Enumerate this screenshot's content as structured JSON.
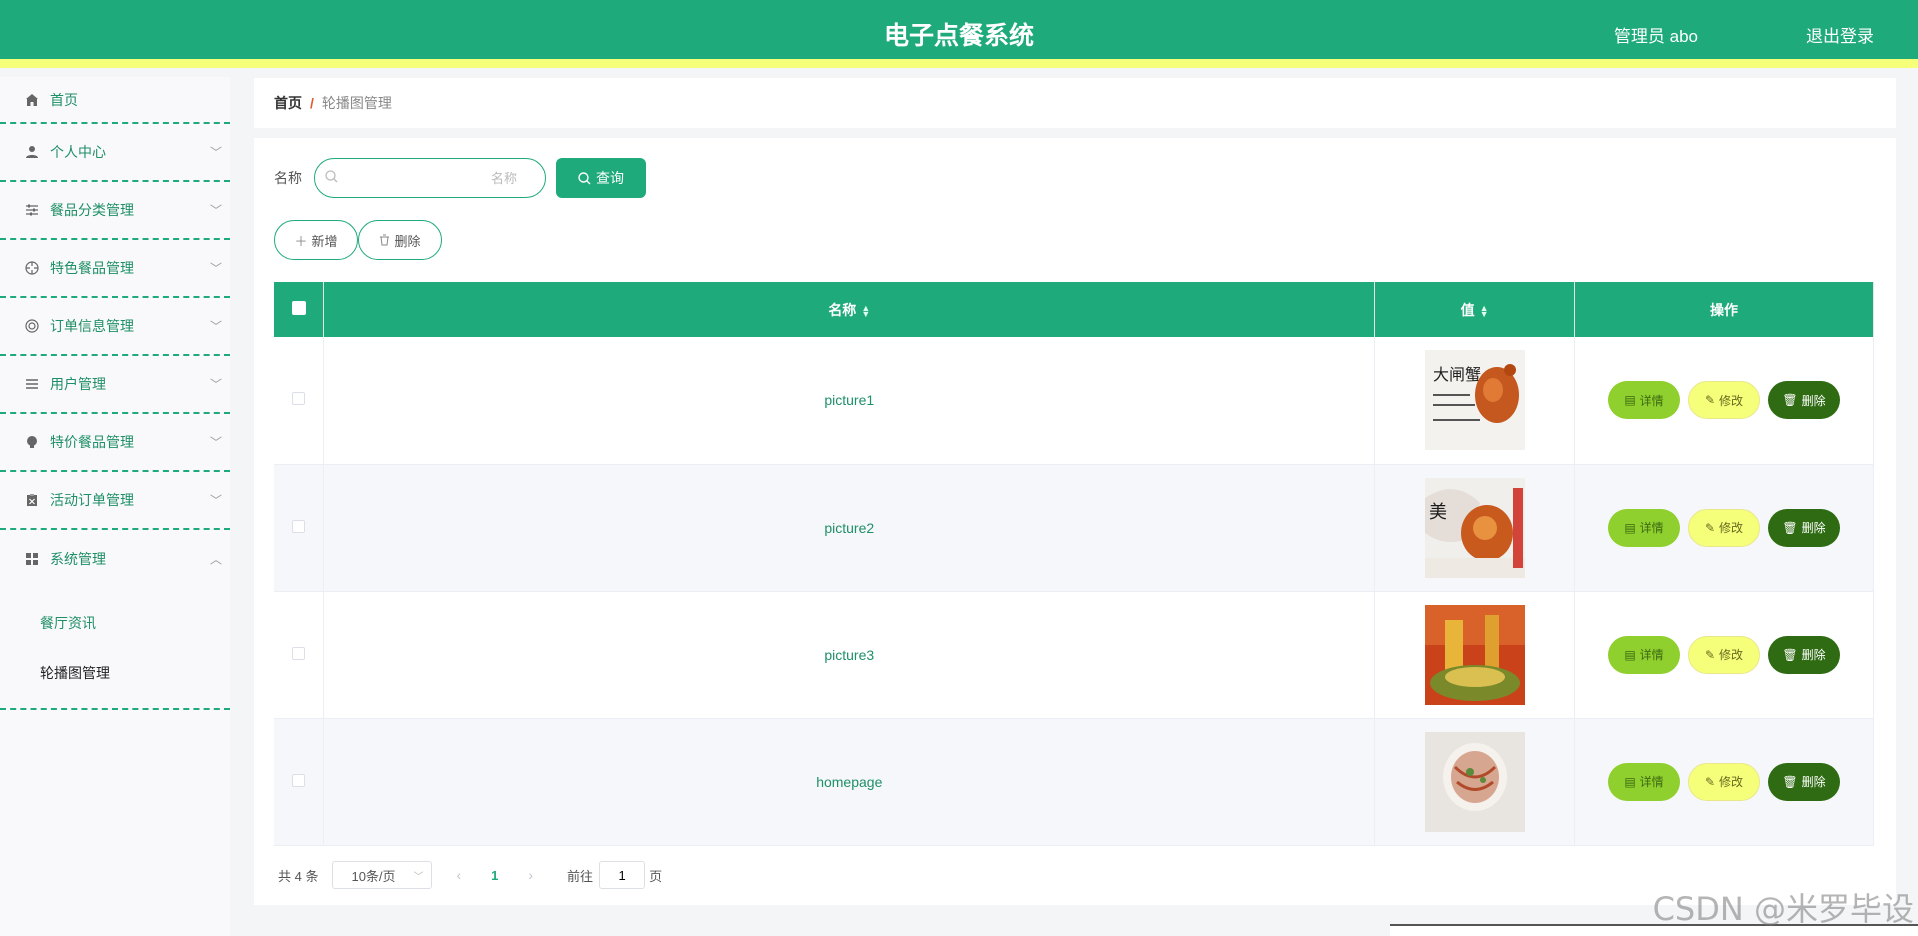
{
  "header": {
    "title": "电子点餐系统",
    "admin_label": "管理员 abo",
    "logout_label": "退出登录",
    "colors": {
      "primary": "#1eaa7a",
      "accent_strip": "#f6ff7a"
    }
  },
  "sidebar": {
    "items": [
      {
        "label": "首页",
        "icon": "home-icon"
      },
      {
        "label": "个人中心",
        "icon": "user-icon"
      },
      {
        "label": "餐品分类管理",
        "icon": "sliders-icon"
      },
      {
        "label": "特色餐品管理",
        "icon": "target-icon"
      },
      {
        "label": "订单信息管理",
        "icon": "circle-icon"
      },
      {
        "label": "用户管理",
        "icon": "list-icon"
      },
      {
        "label": "特价餐品管理",
        "icon": "bulb-icon"
      },
      {
        "label": "活动订单管理",
        "icon": "clipboard-icon"
      },
      {
        "label": "系统管理",
        "icon": "grid-icon"
      }
    ],
    "submenu": [
      {
        "label": "餐厅资讯"
      },
      {
        "label": "轮播图管理"
      }
    ]
  },
  "breadcrumb": {
    "home": "首页",
    "separator": "/",
    "current": "轮播图管理"
  },
  "search": {
    "label": "名称",
    "placeholder": "名称",
    "value": "",
    "button_label": "查询"
  },
  "actions": {
    "add_label": "新增",
    "delete_label": "删除"
  },
  "table": {
    "columns": {
      "name": "名称",
      "value": "值",
      "ops": "操作"
    },
    "op_labels": {
      "detail": "详情",
      "edit": "修改",
      "delete": "删除"
    },
    "rows": [
      {
        "name": "picture1",
        "image": "food-photo-1"
      },
      {
        "name": "picture2",
        "image": "food-photo-2"
      },
      {
        "name": "picture3",
        "image": "food-photo-3"
      },
      {
        "name": "homepage",
        "image": "food-photo-4"
      }
    ]
  },
  "pagination": {
    "total_label": "共 4 条",
    "page_size": "10条/页",
    "current_page": "1",
    "goto_label": "前往",
    "goto_value": "1",
    "page_suffix": "页"
  },
  "watermark": "CSDN @米罗毕设"
}
